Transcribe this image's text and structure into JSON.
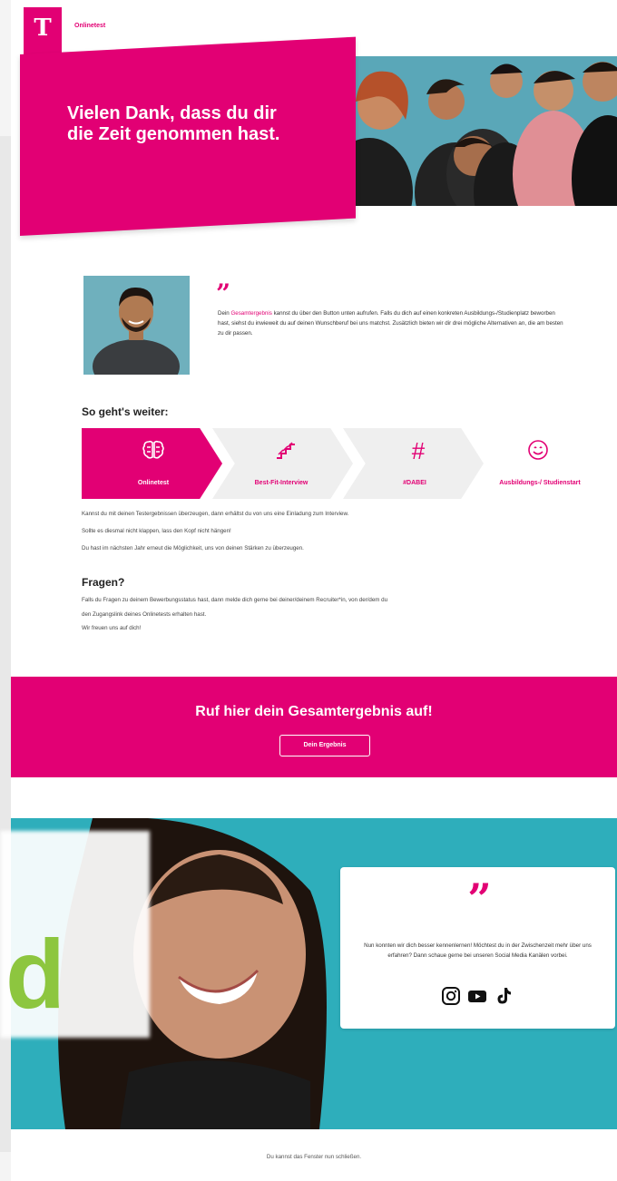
{
  "header": {
    "logo": "T",
    "link_label": "Onlinetest"
  },
  "hero": {
    "title": "Vielen Dank, dass du dir die Zeit genommen hast."
  },
  "quote": {
    "text_before": "Dein ",
    "highlight": "Gesamtergebnis",
    "text_after": " kannst du über den Button unten aufrufen. Falls du dich auf einen konkreten Ausbildungs-/Studienplatz beworben hast, siehst du inwieweit du auf deinen Wunschberuf bei uns matchst. Zusätzlich bieten wir dir drei mögliche Alternativen an, die am besten zu dir passen."
  },
  "steps": {
    "title": "So geht's weiter:",
    "items": [
      {
        "label": "Onlinetest",
        "icon": "brain-icon"
      },
      {
        "label": "Best-Fit-Interview",
        "icon": "stairs-icon"
      },
      {
        "label": "#DABEI",
        "icon": "hashtag-icon"
      },
      {
        "label": "Ausbildungs-/ Studienstart",
        "icon": "smiley-icon"
      }
    ]
  },
  "info": {
    "line1": "Kannst du mit deinen Testergebnissen überzeugen, dann erhältst du von uns eine Einladung zum Interview.",
    "line2": "Sollte es diesmal nicht klappen, lass den Kopf nicht hängen!",
    "line3": "Du hast im nächsten Jahr erneut die Möglichkeit, uns von deinen Stärken zu überzeugen."
  },
  "fragen": {
    "title": "Fragen?",
    "line1": "Falls du Fragen zu deinem Bewerbungsstatus hast, dann melde dich gerne bei deiner/deinem Recruiter*in, von der/dem du",
    "line2": "den Zugangslink deines Onlinetests erhalten hast.",
    "line3": "Wir freuen uns auf dich!"
  },
  "banner": {
    "title": "Ruf hier dein Gesamtergebnis auf!",
    "button": "Dein Ergebnis"
  },
  "card": {
    "text": "Nun konnten wir dich besser kennenlernen! Möchtest du in der Zwischenzeit mehr über uns erfahren? Dann schaue gerne bei unseren Social Media Kanälen vorbei.",
    "icons": [
      "instagram-icon",
      "youtube-icon",
      "tiktok-icon"
    ]
  },
  "overlay_letter": "d",
  "footer": {
    "text": "Du kannst das Fenster nun schließen."
  },
  "colors": {
    "brand": "#e20074",
    "overlay_letter": "#8dc63f",
    "teal": "#2fb0bd"
  }
}
